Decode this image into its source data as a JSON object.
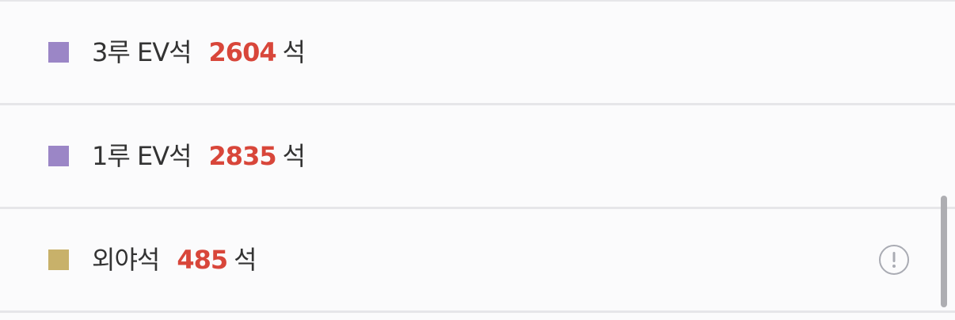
{
  "rows": [
    {
      "label": "3루 EV석",
      "count": "2604",
      "unit": "석",
      "color": "#9b86c6"
    },
    {
      "label": "1루 EV석",
      "count": "2835",
      "unit": "석",
      "color": "#9b86c6"
    },
    {
      "label": "외야석",
      "count": "485",
      "unit": "석",
      "color": "#c8b16a",
      "icon": "info-icon"
    }
  ],
  "colors": {
    "count": "#d8463a",
    "text": "#333333",
    "divider": "#e6e6e9",
    "background": "#fbfbfc"
  }
}
